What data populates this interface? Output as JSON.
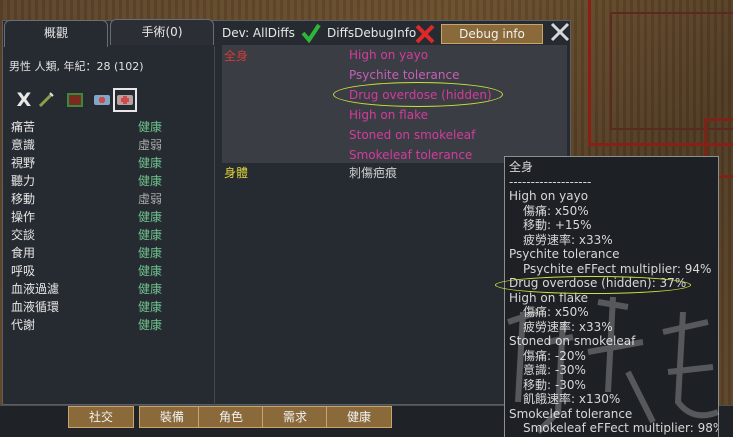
{
  "tabs": {
    "overview": "概觀",
    "operations": "手術(0)"
  },
  "pawn": {
    "info": "男性 人類, 年紀：28 (102)"
  },
  "filters": {
    "x_label": "X"
  },
  "capacities": [
    {
      "name": "痛苦",
      "value": "健康",
      "weak": false
    },
    {
      "name": "意識",
      "value": "虛弱",
      "weak": true
    },
    {
      "name": "視野",
      "value": "健康",
      "weak": false
    },
    {
      "name": "聽力",
      "value": "健康",
      "weak": false
    },
    {
      "name": "移動",
      "value": "虛弱",
      "weak": true
    },
    {
      "name": "操作",
      "value": "健康",
      "weak": false
    },
    {
      "name": "交談",
      "value": "健康",
      "weak": false
    },
    {
      "name": "食用",
      "value": "健康",
      "weak": false
    },
    {
      "name": "呼吸",
      "value": "健康",
      "weak": false
    },
    {
      "name": "血液過濾",
      "value": "健康",
      "weak": false
    },
    {
      "name": "血液循環",
      "value": "健康",
      "weak": false
    },
    {
      "name": "代謝",
      "value": "健康",
      "weak": false
    }
  ],
  "dev": {
    "all_diffs": "Dev: AllDiffs",
    "diffs_debug": "DiffsDebugInfo",
    "debug_button": "Debug info"
  },
  "hediffs": {
    "part_whole": "全身",
    "list": [
      "High on yayo",
      "Psychite tolerance",
      "Drug overdose (hidden)",
      "High on flake",
      "Stoned on smokeleaf",
      "Smokeleaf tolerance"
    ],
    "part_body": "身體",
    "body_item": "刺傷疤痕"
  },
  "bottom": {
    "b1": "社交",
    "b2": "裝備",
    "b3": "角色",
    "b4": "需求",
    "b5": "健康"
  },
  "tooltip": [
    {
      "t": "全身",
      "ind": false
    },
    {
      "t": "-------------------",
      "ind": false
    },
    {
      "t": "High on yayo",
      "ind": false
    },
    {
      "t": "傷痛: x50%",
      "ind": true
    },
    {
      "t": "移動: +15%",
      "ind": true
    },
    {
      "t": "疲勞速率: x33%",
      "ind": true
    },
    {
      "t": "Psychite tolerance",
      "ind": false
    },
    {
      "t": "Psychite eFFect multiplier: 94%",
      "ind": true
    },
    {
      "t": "Drug overdose (hidden): 37%",
      "ind": false
    },
    {
      "t": "High on flake",
      "ind": false
    },
    {
      "t": "傷痛: x50%",
      "ind": true
    },
    {
      "t": "疲勞速率: x33%",
      "ind": true
    },
    {
      "t": "Stoned on smokeleaf",
      "ind": false
    },
    {
      "t": "傷痛: -20%",
      "ind": true
    },
    {
      "t": "意識: -30%",
      "ind": true
    },
    {
      "t": "移動: -30%",
      "ind": true
    },
    {
      "t": "飢餓速率: x130%",
      "ind": true
    },
    {
      "t": "Smokeleaf tolerance",
      "ind": false
    },
    {
      "t": "Smokeleaf eFFect multiplier: 98%",
      "ind": true
    }
  ],
  "colors": {
    "healthy": "#6fc08e",
    "hediff": "#d43b9c",
    "part_red": "#d23a3a",
    "part_yellow": "#e1d33a",
    "highlight": "#cfe03a"
  }
}
